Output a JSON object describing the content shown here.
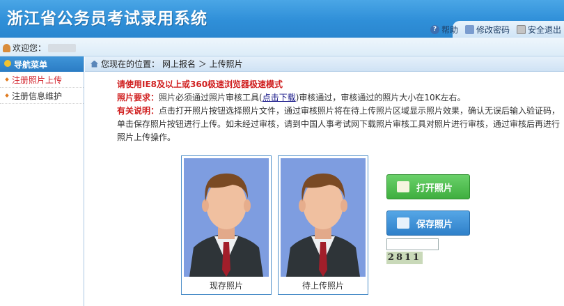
{
  "header": {
    "title": "浙江省公务员考试录用系统",
    "toolbar": [
      {
        "label": "帮助",
        "icon": "help-icon"
      },
      {
        "label": "修改密码",
        "icon": "password-icon"
      },
      {
        "label": "安全退出",
        "icon": "exit-icon"
      }
    ]
  },
  "welcome": {
    "label": "欢迎您："
  },
  "sidebar": {
    "title": "导航菜单",
    "items": [
      {
        "label": "注册照片上传",
        "active": true
      },
      {
        "label": "注册信息维护",
        "active": false
      }
    ]
  },
  "breadcrumb": {
    "prefix": "您现在的位置：",
    "path": "网上报名 ＞ 上传照片"
  },
  "notes": {
    "browser_warning": "请使用IE8及以上或360极速浏览器极速模式",
    "req_label": "照片要求：",
    "req_text1": "照片必须通过照片审核工具(",
    "req_link": "点击下载",
    "req_text2": ")审核通过，审核通过的照片大小在10K左右。",
    "info_label": "有关说明：",
    "info_text": "点击打开照片按钮选择照片文件，通过审核照片将在待上传照片区域显示照片效果，确认无误后输入验证码，单击保存照片按钮进行上传。如未经过审核，请到中国人事考试网下载照片审核工具对照片进行审核，通过审核后再进行照片上传操作。"
  },
  "photos": {
    "current_caption": "现存照片",
    "pending_caption": "待上传照片"
  },
  "buttons": {
    "open_label": "打开照片",
    "save_label": "保存照片"
  },
  "captcha": {
    "value": "",
    "code": "2811"
  },
  "colors": {
    "header": "#2f8fd8",
    "accent_red": "#d01f1f",
    "green_button": "#4fbf4f",
    "blue_button": "#3a8ed6",
    "photo_bg": "#7e9de0"
  }
}
